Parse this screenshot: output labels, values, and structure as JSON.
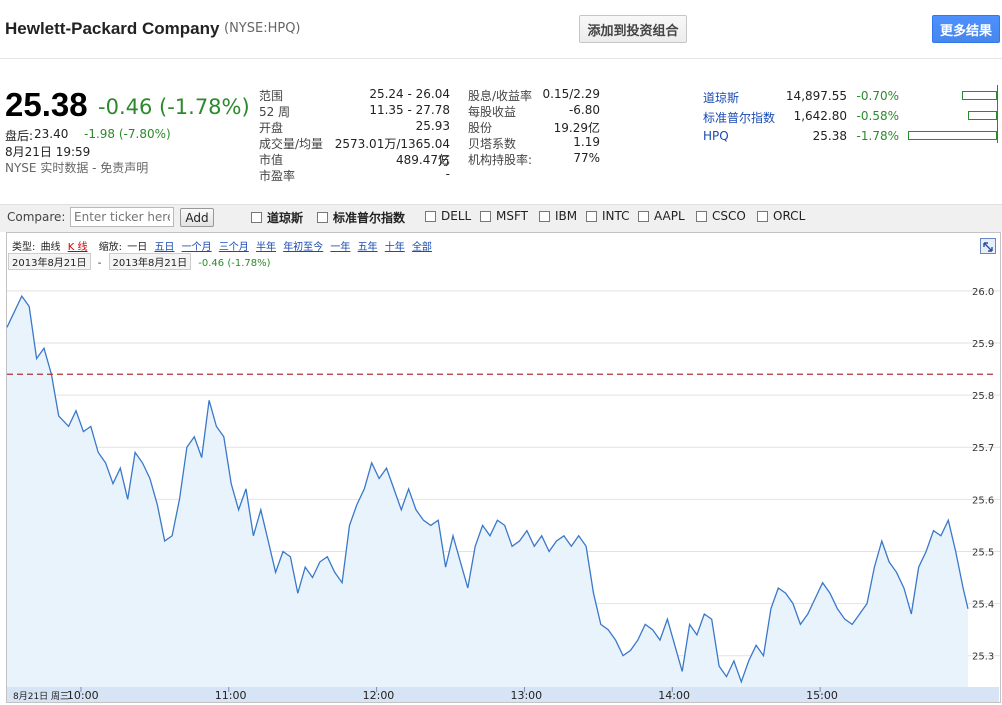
{
  "header": {
    "company": "Hewlett-Packard Company",
    "ticker": "(NYSE:HPQ)",
    "add_portfolio": "添加到投资组合",
    "more_results": "更多结果"
  },
  "quote": {
    "price": "25.38",
    "change": "-0.46 (-1.78%)",
    "after_label": "盘后:",
    "after_price": "23.40",
    "after_change": "-1.98 (-7.80%)",
    "date_time": "8月21日 19:59",
    "disclaimer": "NYSE 实时数据 - 免责声明"
  },
  "stats_left": [
    {
      "label": "范围",
      "value": "25.24 - 26.04"
    },
    {
      "label": "52 周",
      "value": "11.35 - 27.78"
    },
    {
      "label": "开盘",
      "value": "25.93"
    },
    {
      "label": "成交量/均量",
      "value": "2573.01万/1365.04万"
    },
    {
      "label": "市值",
      "value": "489.47亿"
    },
    {
      "label": "市盈率",
      "value": "-"
    }
  ],
  "stats_right": [
    {
      "label": "股息/收益率",
      "value": "0.15/2.29"
    },
    {
      "label": "每股收益",
      "value": "-6.80"
    },
    {
      "label": "股份",
      "value": "19.29亿"
    },
    {
      "label": "贝塔系数",
      "value": "1.19"
    },
    {
      "label": "机构持股率:",
      "value": "77%"
    }
  ],
  "indices": [
    {
      "name": "道琼斯",
      "value": "14,897.55",
      "change": "-0.70%",
      "bar_pct": 0.7
    },
    {
      "name": "标准普尔指数",
      "value": "1,642.80",
      "change": "-0.58%",
      "bar_pct": 0.58
    },
    {
      "name": "HPQ",
      "value": "25.38",
      "change": "-1.78%",
      "bar_pct": 1.78
    }
  ],
  "compare": {
    "label": "Compare:",
    "placeholder": "Enter ticker here",
    "add": "Add",
    "options": [
      {
        "label": "道琼斯",
        "bold": true
      },
      {
        "label": "标准普尔指数",
        "bold": true
      },
      {
        "label": "DELL"
      },
      {
        "label": "MSFT"
      },
      {
        "label": "IBM"
      },
      {
        "label": "INTC"
      },
      {
        "label": "AAPL"
      },
      {
        "label": "CSCO"
      },
      {
        "label": "ORCL"
      }
    ]
  },
  "chart_toolbar": {
    "type_label": "类型:",
    "type_line": "曲线",
    "type_k": "K 线",
    "zoom_label": "缩放:",
    "zoom_current": "一日",
    "zoom_links": [
      "五日",
      "一个月",
      "三个月",
      "半年",
      "年初至今",
      "一年",
      "五年",
      "十年",
      "全部"
    ],
    "range_from": "2013年8月21日",
    "range_sep": "-",
    "range_to": "2013年8月21日",
    "range_change": "-0.46 (-1.78%)"
  },
  "chart_data": {
    "type": "area",
    "x_axis_labels": [
      "8月21日 周三",
      "10:00",
      "11:00",
      "12:00",
      "13:00",
      "14:00",
      "15:00"
    ],
    "y_ticks": [
      "26.0",
      "25.9",
      "25.8",
      "25.7",
      "25.6",
      "25.5",
      "25.4",
      "25.3"
    ],
    "ylim": [
      25.24,
      26.04
    ],
    "reference_line": 25.84,
    "colors": {
      "line": "#3a78c9",
      "fill": "#e9f3fc",
      "reference": "#b3333a"
    },
    "time_start": "09:30",
    "time_end": "16:00",
    "x": [
      "09:30",
      "09:33",
      "09:36",
      "09:39",
      "09:42",
      "09:45",
      "09:48",
      "09:51",
      "09:55",
      "09:58",
      "10:01",
      "10:04",
      "10:07",
      "10:10",
      "10:13",
      "10:16",
      "10:19",
      "10:22",
      "10:25",
      "10:28",
      "10:31",
      "10:34",
      "10:37",
      "10:40",
      "10:43",
      "10:46",
      "10:49",
      "10:52",
      "10:55",
      "10:58",
      "11:01",
      "11:04",
      "11:07",
      "11:10",
      "11:13",
      "11:16",
      "11:19",
      "11:22",
      "11:25",
      "11:28",
      "11:31",
      "11:34",
      "11:37",
      "11:40",
      "11:43",
      "11:46",
      "11:49",
      "11:52",
      "11:55",
      "11:58",
      "12:01",
      "12:04",
      "12:07",
      "12:10",
      "12:13",
      "12:16",
      "12:19",
      "12:22",
      "12:25",
      "12:28",
      "12:31",
      "12:34",
      "12:37",
      "12:40",
      "12:43",
      "12:46",
      "12:49",
      "12:52",
      "12:55",
      "12:58",
      "13:01",
      "13:04",
      "13:07",
      "13:10",
      "13:13",
      "13:16",
      "13:19",
      "13:22",
      "13:25",
      "13:28",
      "13:31",
      "13:34",
      "13:37",
      "13:40",
      "13:43",
      "13:46",
      "13:49",
      "13:52",
      "13:55",
      "13:58",
      "14:01",
      "14:04",
      "14:07",
      "14:10",
      "14:13",
      "14:16",
      "14:19",
      "14:22",
      "14:25",
      "14:28",
      "14:31",
      "14:34",
      "14:37",
      "14:40",
      "14:43",
      "14:46",
      "14:49",
      "14:52",
      "14:55",
      "14:58",
      "15:01",
      "15:04",
      "15:07",
      "15:10",
      "15:13",
      "15:16",
      "15:19",
      "15:22",
      "15:25",
      "15:28",
      "15:31",
      "15:34",
      "15:37",
      "15:40",
      "15:43",
      "15:46",
      "15:49",
      "15:52",
      "15:55",
      "15:58",
      "16:00"
    ],
    "series": [
      {
        "values": [
          25.93,
          25.96,
          25.99,
          25.97,
          25.87,
          25.89,
          25.84,
          25.76,
          25.74,
          25.77,
          25.73,
          25.74,
          25.69,
          25.67,
          25.63,
          25.66,
          25.6,
          25.69,
          25.67,
          25.64,
          25.59,
          25.52,
          25.53,
          25.6,
          25.7,
          25.72,
          25.68,
          25.79,
          25.74,
          25.72,
          25.63,
          25.58,
          25.62,
          25.53,
          25.58,
          25.52,
          25.46,
          25.5,
          25.49,
          25.42,
          25.47,
          25.45,
          25.48,
          25.49,
          25.46,
          25.44,
          25.55,
          25.59,
          25.62,
          25.67,
          25.64,
          25.66,
          25.62,
          25.58,
          25.62,
          25.58,
          25.56,
          25.55,
          25.56,
          25.47,
          25.53,
          25.48,
          25.43,
          25.51,
          25.55,
          25.53,
          25.56,
          25.55,
          25.51,
          25.52,
          25.54,
          25.51,
          25.53,
          25.5,
          25.52,
          25.53,
          25.51,
          25.53,
          25.51,
          25.42,
          25.36,
          25.35,
          25.33,
          25.3,
          25.31,
          25.33,
          25.36,
          25.35,
          25.33,
          25.37,
          25.32,
          25.27,
          25.36,
          25.34,
          25.38,
          25.37,
          25.28,
          25.26,
          25.29,
          25.25,
          25.29,
          25.32,
          25.3,
          25.39,
          25.43,
          25.42,
          25.4,
          25.36,
          25.38,
          25.41,
          25.44,
          25.42,
          25.39,
          25.37,
          25.36,
          25.38,
          25.4,
          25.47,
          25.52,
          25.48,
          25.46,
          25.43,
          25.38,
          25.47,
          25.5,
          25.54,
          25.53,
          25.56,
          25.5,
          25.43,
          25.39
        ]
      }
    ]
  }
}
